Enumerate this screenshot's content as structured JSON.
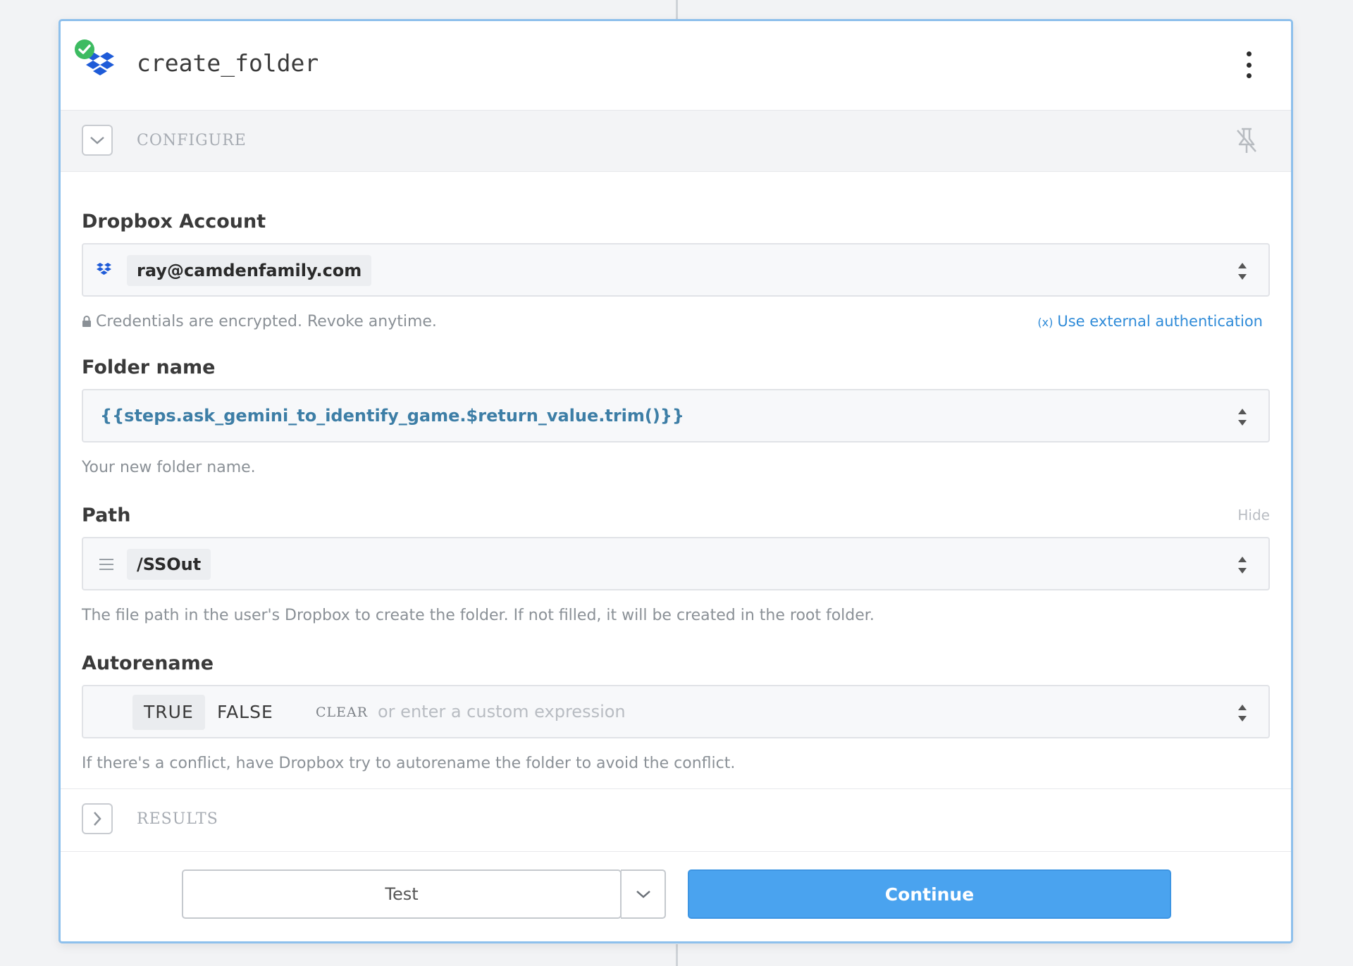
{
  "step": {
    "title": "create_folder",
    "app_icon": "dropbox-icon",
    "status_icon": "check-circle-icon",
    "menu_icon": "kebab-menu-icon"
  },
  "configure": {
    "label": "CONFIGURE",
    "toggle_icon": "chevron-down-icon",
    "pin_icon": "pin-icon"
  },
  "fields": {
    "account": {
      "label": "Dropbox Account",
      "value": "ray@camdenfamily.com",
      "credentials_note": "Credentials are encrypted. Revoke anytime.",
      "external_auth_link": "Use external authentication",
      "external_auth_prefix": "(x)"
    },
    "folder_name": {
      "label": "Folder name",
      "value": "{{steps.ask_gemini_to_identify_game.$return_value.trim()}}",
      "hint": "Your new folder name."
    },
    "path": {
      "label": "Path",
      "hide_link": "Hide",
      "value": "/SSOut",
      "hint": "The file path in the user's Dropbox to create the folder. If not filled, it will be created in the root folder."
    },
    "autorename": {
      "label": "Autorename",
      "true_label": "TRUE",
      "false_label": "FALSE",
      "clear_label": "CLEAR",
      "placeholder": "or enter a custom expression",
      "hint": "If there's a conflict, have Dropbox try to autorename the folder to avoid the conflict."
    }
  },
  "results": {
    "label": "RESULTS",
    "toggle_icon": "chevron-right-icon"
  },
  "footer": {
    "test_label": "Test",
    "continue_label": "Continue"
  },
  "colors": {
    "accent": "#4aa3ef",
    "card_border": "#8ec0ec",
    "expression_text": "#3d7ea6",
    "success": "#3dbb61",
    "dropbox_blue": "#1e5bd8"
  }
}
